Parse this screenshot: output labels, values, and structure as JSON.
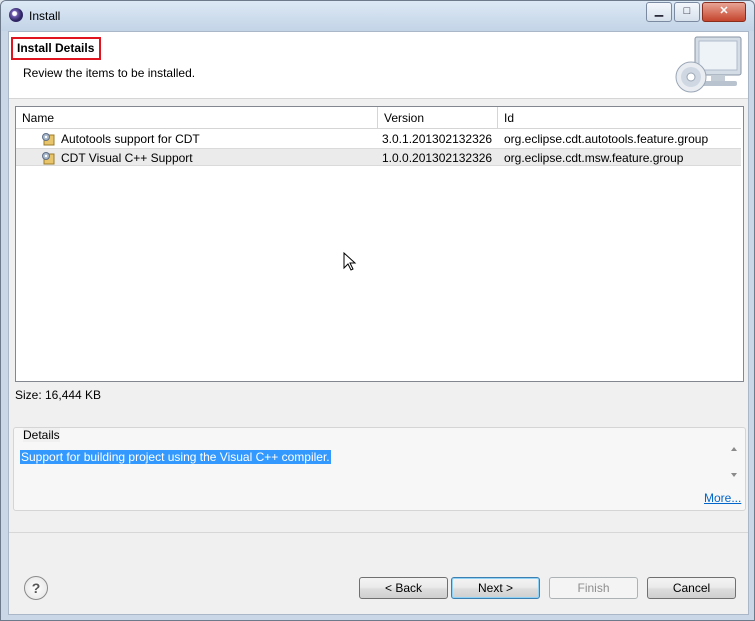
{
  "window": {
    "title": "Install",
    "controls": {
      "minimize": "▁",
      "maximize": "□",
      "close": "✕"
    }
  },
  "header": {
    "title": "Install Details",
    "subtitle": "Review the items to be installed."
  },
  "table": {
    "columns": [
      "Name",
      "Version",
      "Id"
    ],
    "rows": [
      {
        "name": "Autotools support for CDT",
        "version": "3.0.1.201302132326",
        "id": "org.eclipse.cdt.autotools.feature.group"
      },
      {
        "name": "CDT Visual C++ Support",
        "version": "1.0.0.201302132326",
        "id": "org.eclipse.cdt.msw.feature.group"
      }
    ]
  },
  "size": "Size: 16,444 KB",
  "details": {
    "legend": "Details",
    "text": "Support for building project using the Visual C++ compiler.",
    "more_link": "More..."
  },
  "buttons": {
    "help": "?",
    "back": "< Back",
    "next": "Next >",
    "finish": "Finish",
    "cancel": "Cancel"
  },
  "icons": [
    "eclipse-icon",
    "monitor-cd-icon",
    "feature-icon",
    "help-icon",
    "mouse-cursor-icon"
  ]
}
